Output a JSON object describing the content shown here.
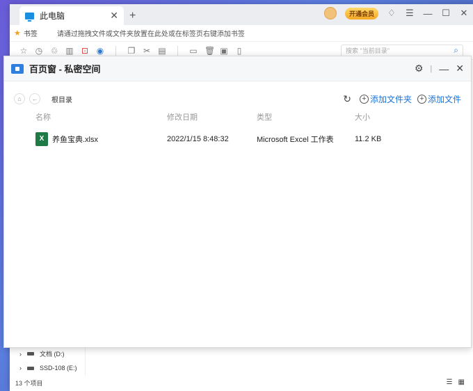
{
  "browser": {
    "tab_title": "此电脑",
    "tab_close": "✕",
    "new_tab": "+",
    "vip_label": "开通会员",
    "bookmark_title": "书签",
    "bookmark_hint": "请通过拖拽文件或文件夹放置在此处或在标签页右键添加书签",
    "search_placeholder": "搜索 \"当前目录\""
  },
  "dialog": {
    "title": "百页窗 - 私密空间",
    "breadcrumb": "根目录",
    "add_folder": "添加文件夹",
    "add_file": "添加文件",
    "columns": {
      "name": "名称",
      "modified": "修改日期",
      "type": "类型",
      "size": "大小"
    },
    "files": [
      {
        "name": "养鱼宝典.xlsx",
        "modified": "2022/1/15 8:48:32",
        "type": "Microsoft Excel 工作表",
        "size": "11.2 KB"
      }
    ]
  },
  "explorer": {
    "drive_d": "文档 (D:)",
    "drive_e": "SSD-108 (E:)",
    "status": "13 个项目"
  },
  "colors": {
    "accent": "#1a73d9",
    "excel": "#1e7b45"
  }
}
